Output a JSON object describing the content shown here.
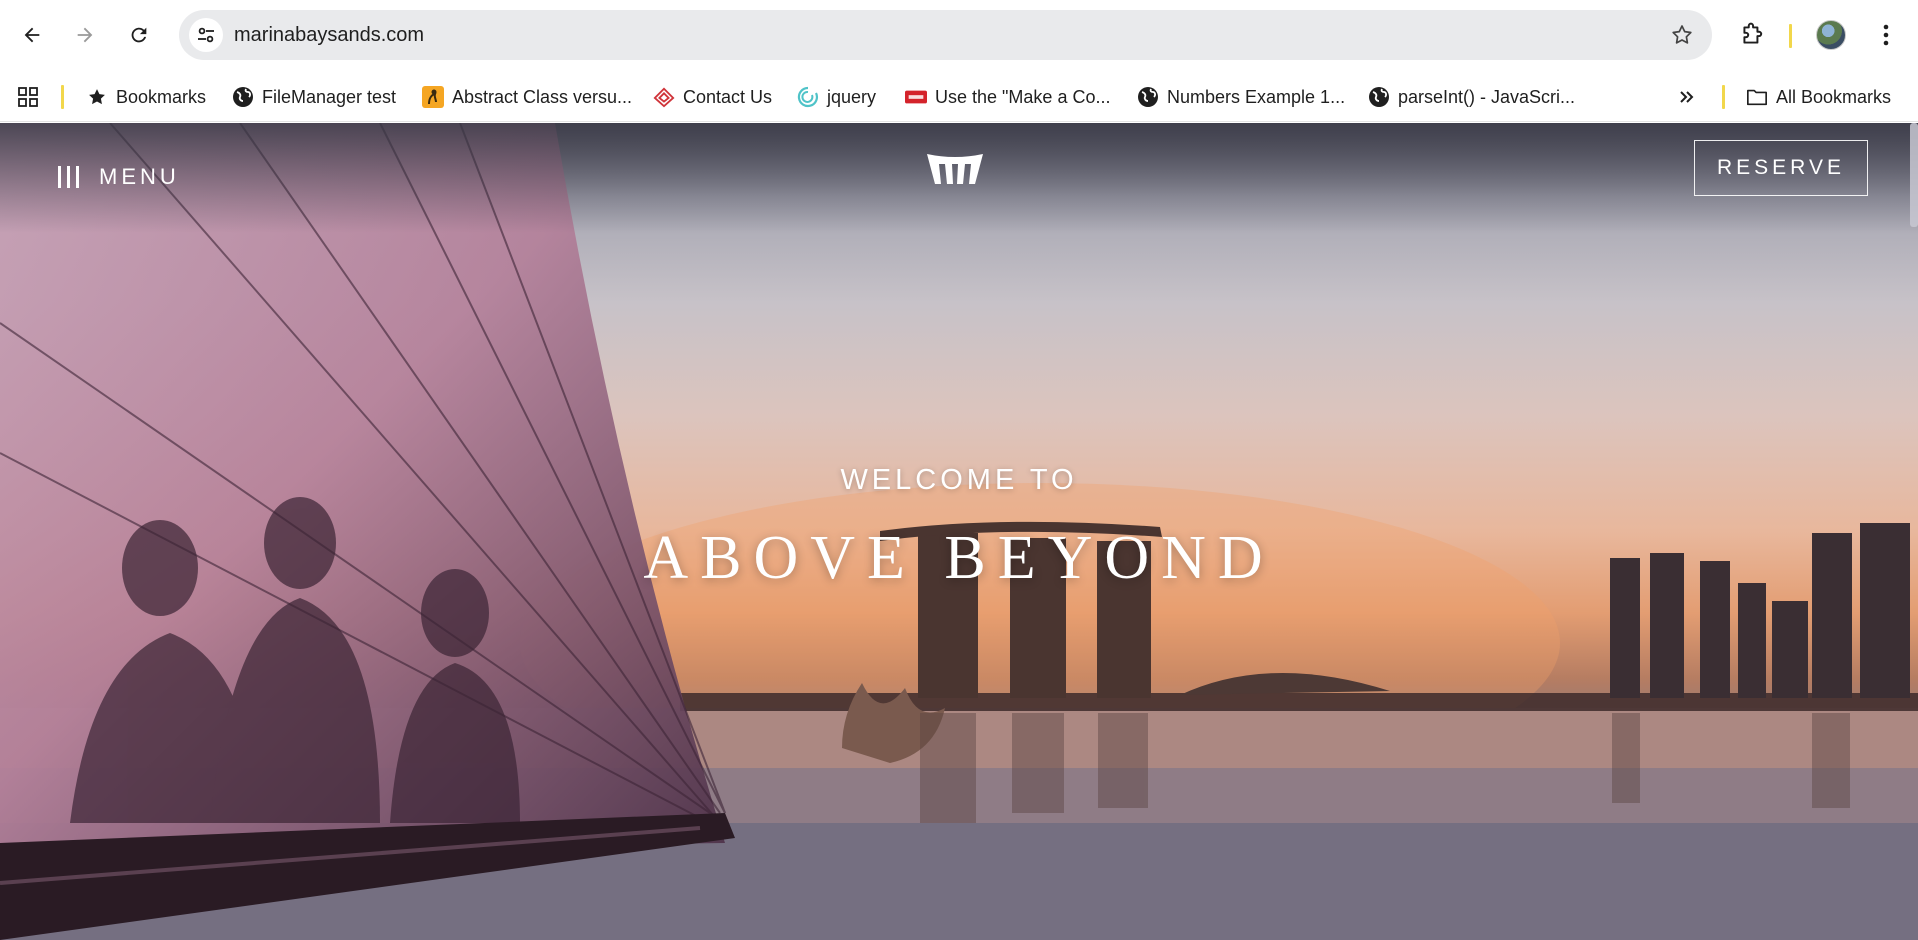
{
  "browser": {
    "url": "marinabaysands.com",
    "bookmarks": [
      {
        "label": "Bookmarks",
        "icon": "star-icon"
      },
      {
        "label": "FileManager test",
        "icon": "globe-icon"
      },
      {
        "label": "Abstract Class versu...",
        "icon": "site-favicon"
      },
      {
        "label": "Contact Us",
        "icon": "site-favicon"
      },
      {
        "label": "jquery",
        "icon": "site-favicon"
      },
      {
        "label": "Use the \"Make a Co...",
        "icon": "site-favicon"
      },
      {
        "label": "Numbers Example 1...",
        "icon": "globe-icon"
      },
      {
        "label": "parseInt() - JavaScri...",
        "icon": "globe-icon"
      }
    ],
    "all_bookmarks": "All Bookmarks"
  },
  "page": {
    "menu_label": "MENU",
    "reserve_label": "RESERVE",
    "welcome": "WELCOME TO",
    "headline": "ABOVE BEYOND"
  },
  "colors": {
    "toolbar_bg": "#ffffff",
    "omnibox_bg": "#e9eaec",
    "separator": "#f2d74b",
    "hero_text": "#ffffff"
  }
}
